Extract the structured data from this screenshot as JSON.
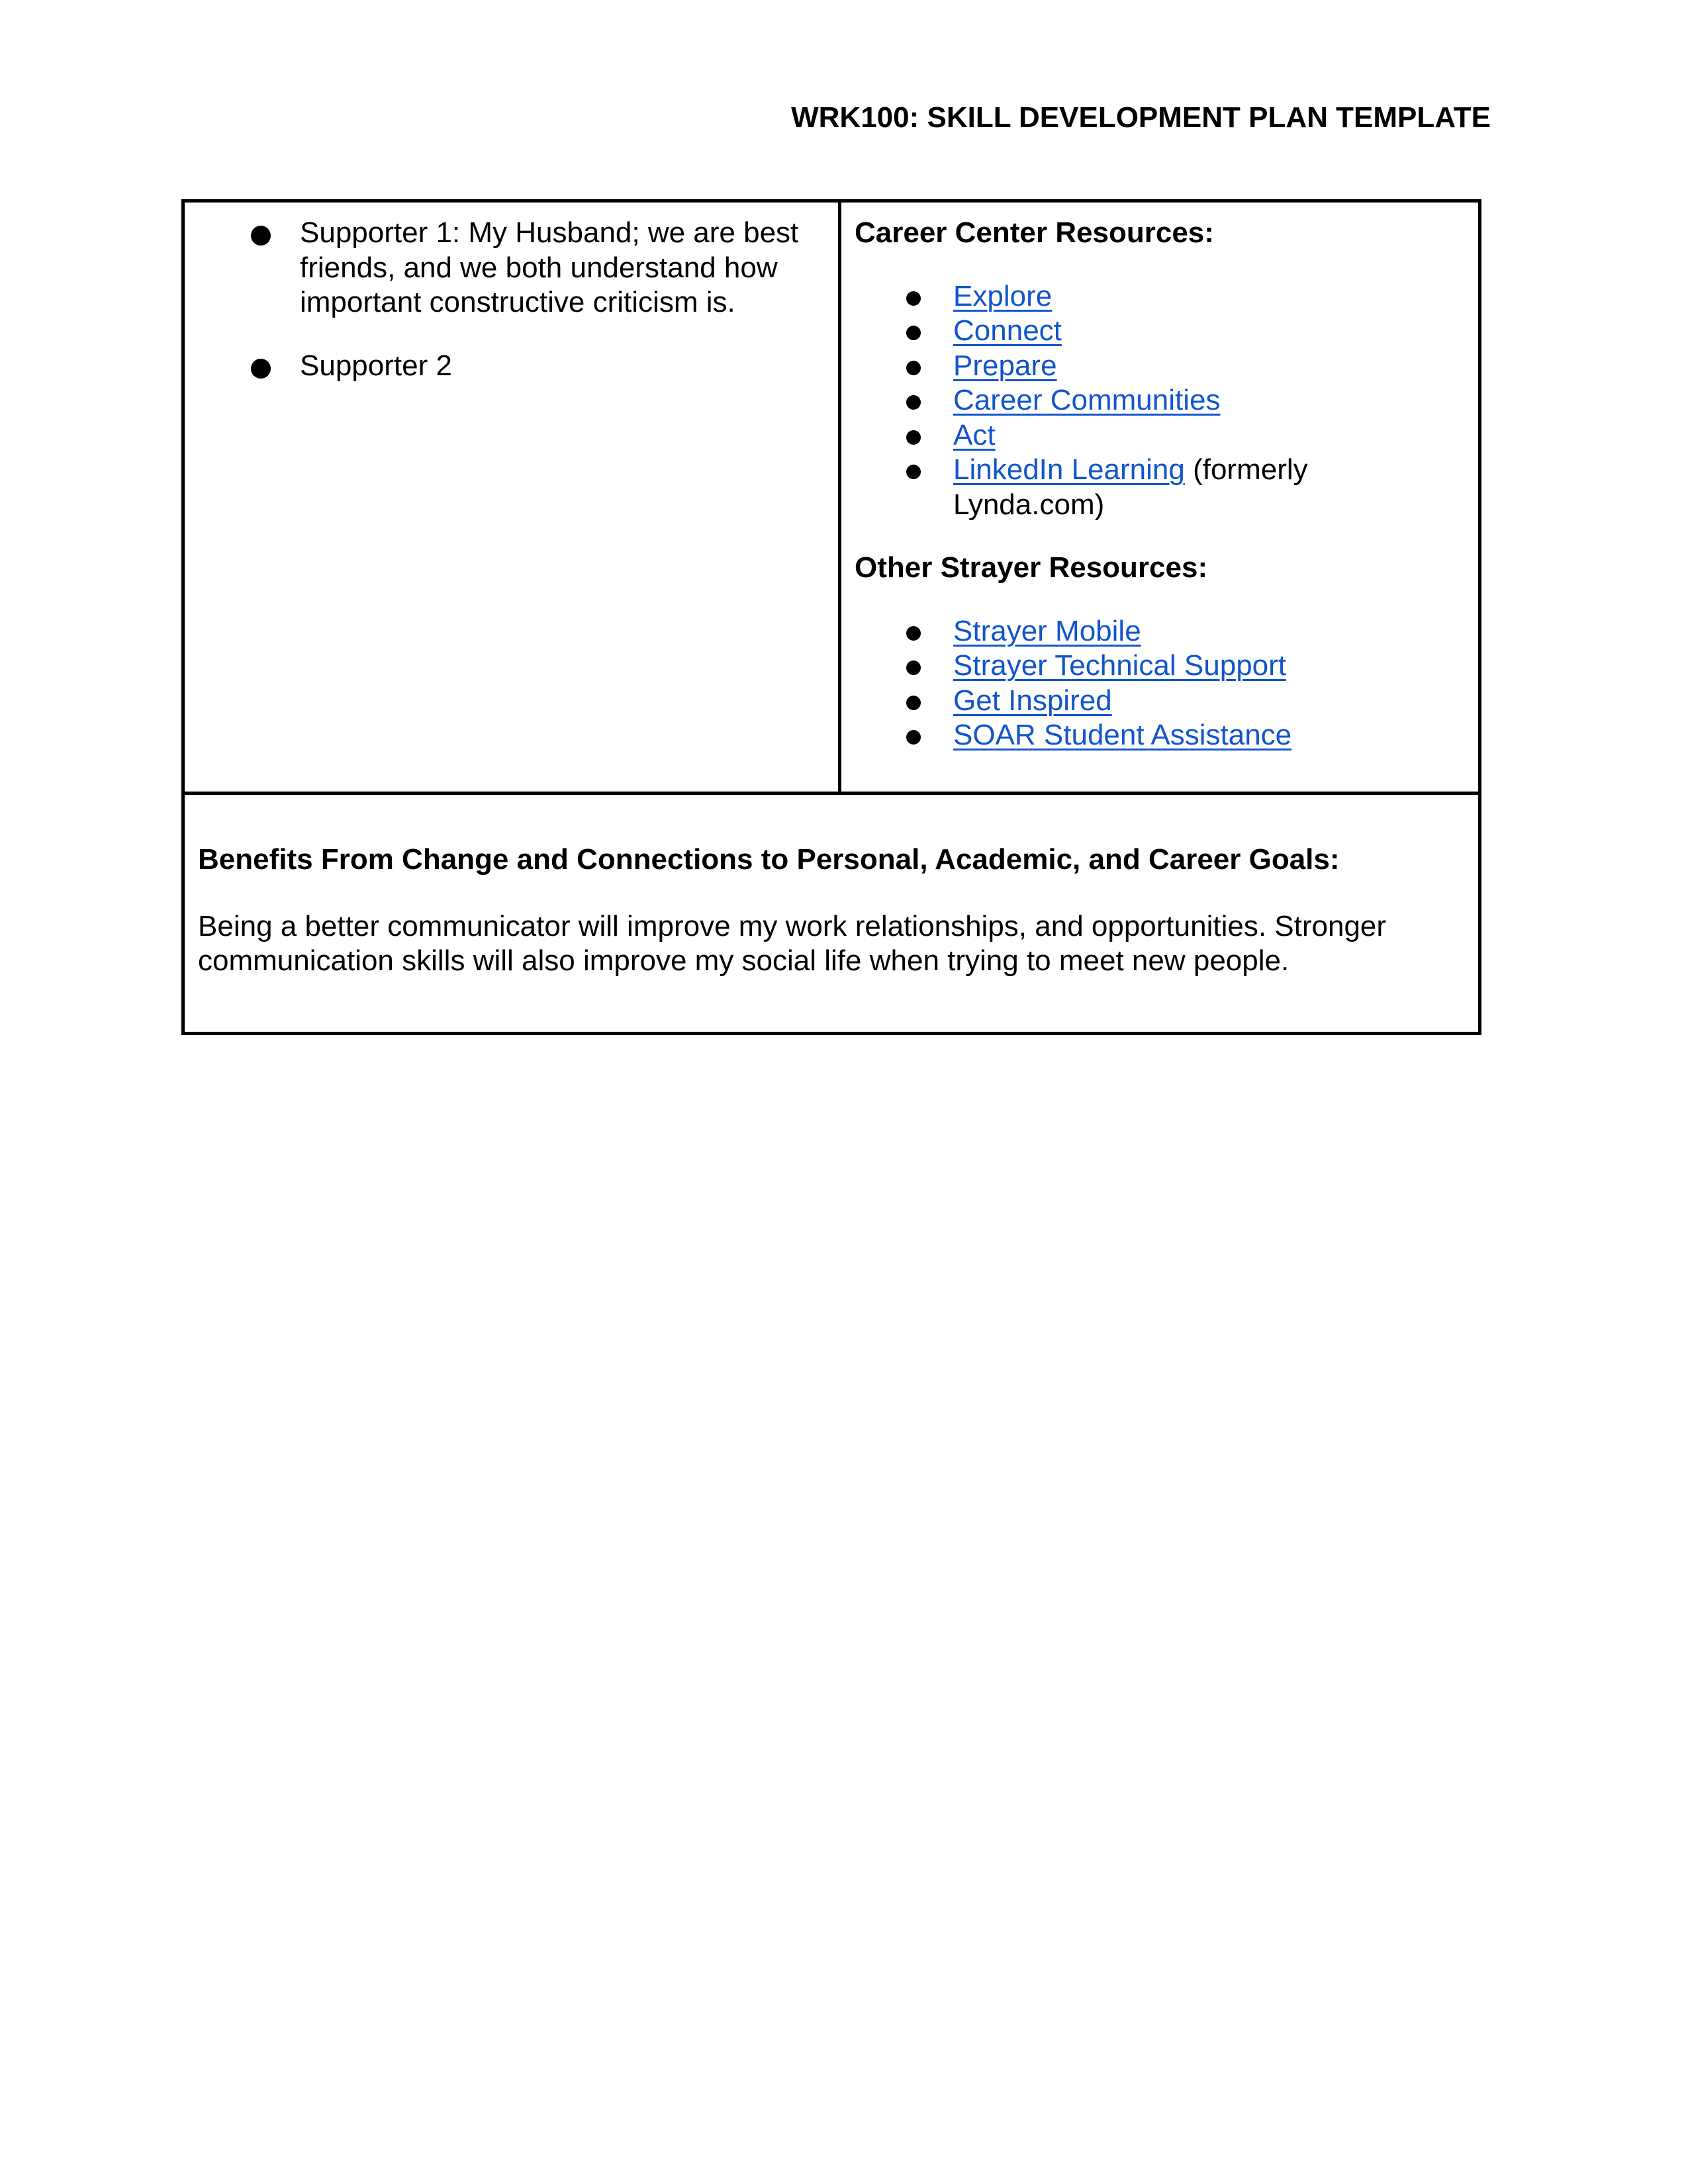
{
  "header": {
    "title": "WRK100: SKILL DEVELOPMENT PLAN TEMPLATE"
  },
  "supporters": [
    {
      "text": "Supporter 1: My Husband; we are best friends, and we both understand how important constructive criticism is."
    },
    {
      "text": "Supporter 2"
    }
  ],
  "career_center": {
    "heading": "Career Center Resources:",
    "links": [
      {
        "label": "Explore",
        "suffix": ""
      },
      {
        "label": "Connect",
        "suffix": ""
      },
      {
        "label": "Prepare",
        "suffix": ""
      },
      {
        "label": "Career Communities",
        "suffix": ""
      },
      {
        "label": "Act",
        "suffix": ""
      },
      {
        "label": "LinkedIn Learning",
        "suffix": " (formerly Lynda.com)"
      }
    ]
  },
  "other_resources": {
    "heading": "Other Strayer Resources:",
    "links": [
      {
        "label": "Strayer Mobile"
      },
      {
        "label": "Strayer Technical Support"
      },
      {
        "label": "Get Inspired"
      },
      {
        "label": "SOAR Student Assistance"
      }
    ]
  },
  "benefits": {
    "heading": "Benefits From Change and Connections to Personal, Academic, and Career Goals:",
    "body": "Being a better communicator will improve my work relationships, and opportunities. Stronger communication skills will also improve my social life when trying to meet new people."
  },
  "colors": {
    "link": "#1155cc",
    "text": "#000000",
    "border": "#000000"
  }
}
